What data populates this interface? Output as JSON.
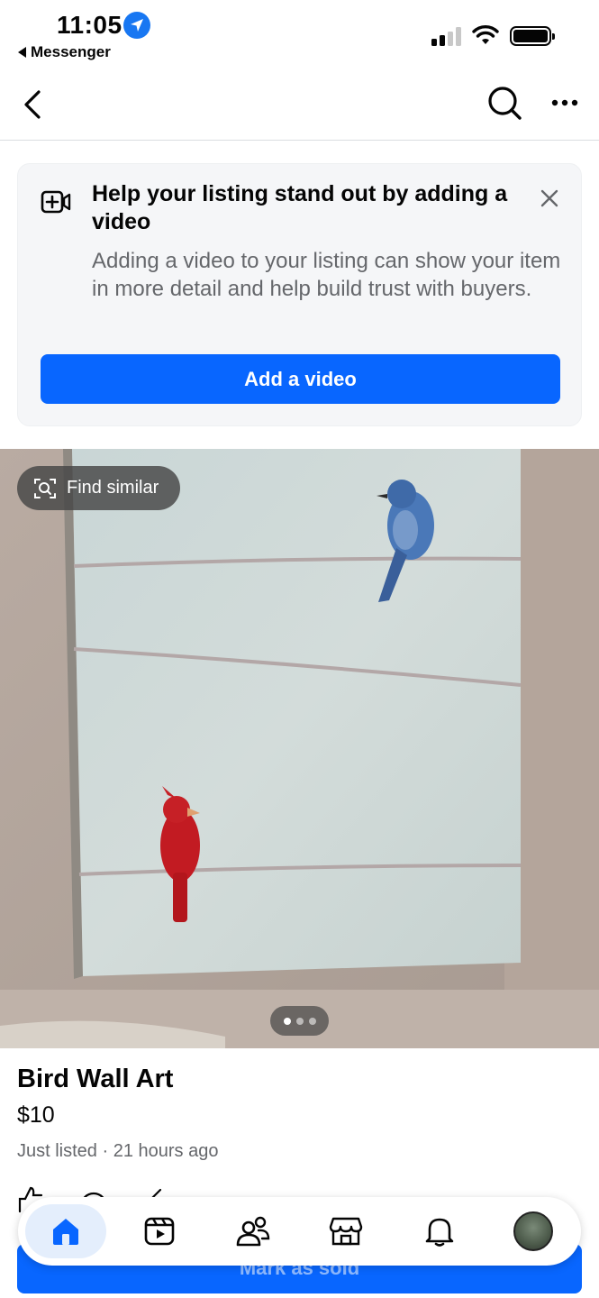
{
  "status_bar": {
    "time": "11:05",
    "back_app": "Messenger"
  },
  "nav": {
    "back_icon": "chevron-left-icon",
    "search_icon": "search-icon",
    "more_icon": "more-horizontal-icon"
  },
  "promo": {
    "title": "Help your listing stand out by adding a video",
    "description": "Adding a video to your listing can show your item in more detail and help build trust with buyers.",
    "button_label": "Add a video",
    "icon": "add-video-icon",
    "close_icon": "close-icon"
  },
  "photo": {
    "find_similar_label": "Find similar",
    "page_count": 3,
    "active_page": 1
  },
  "listing": {
    "title": "Bird Wall Art",
    "price": "$10",
    "meta": "Just listed · 21 hours ago"
  },
  "actions": {
    "mark_sold_label": "Mark as sold"
  },
  "tab_bar": {
    "tabs": [
      "home",
      "video",
      "friends",
      "marketplace",
      "notifications",
      "profile"
    ],
    "active": "home"
  },
  "colors": {
    "accent": "#0866ff",
    "secondary_text": "#65676b",
    "card_bg": "#f5f6f8"
  }
}
